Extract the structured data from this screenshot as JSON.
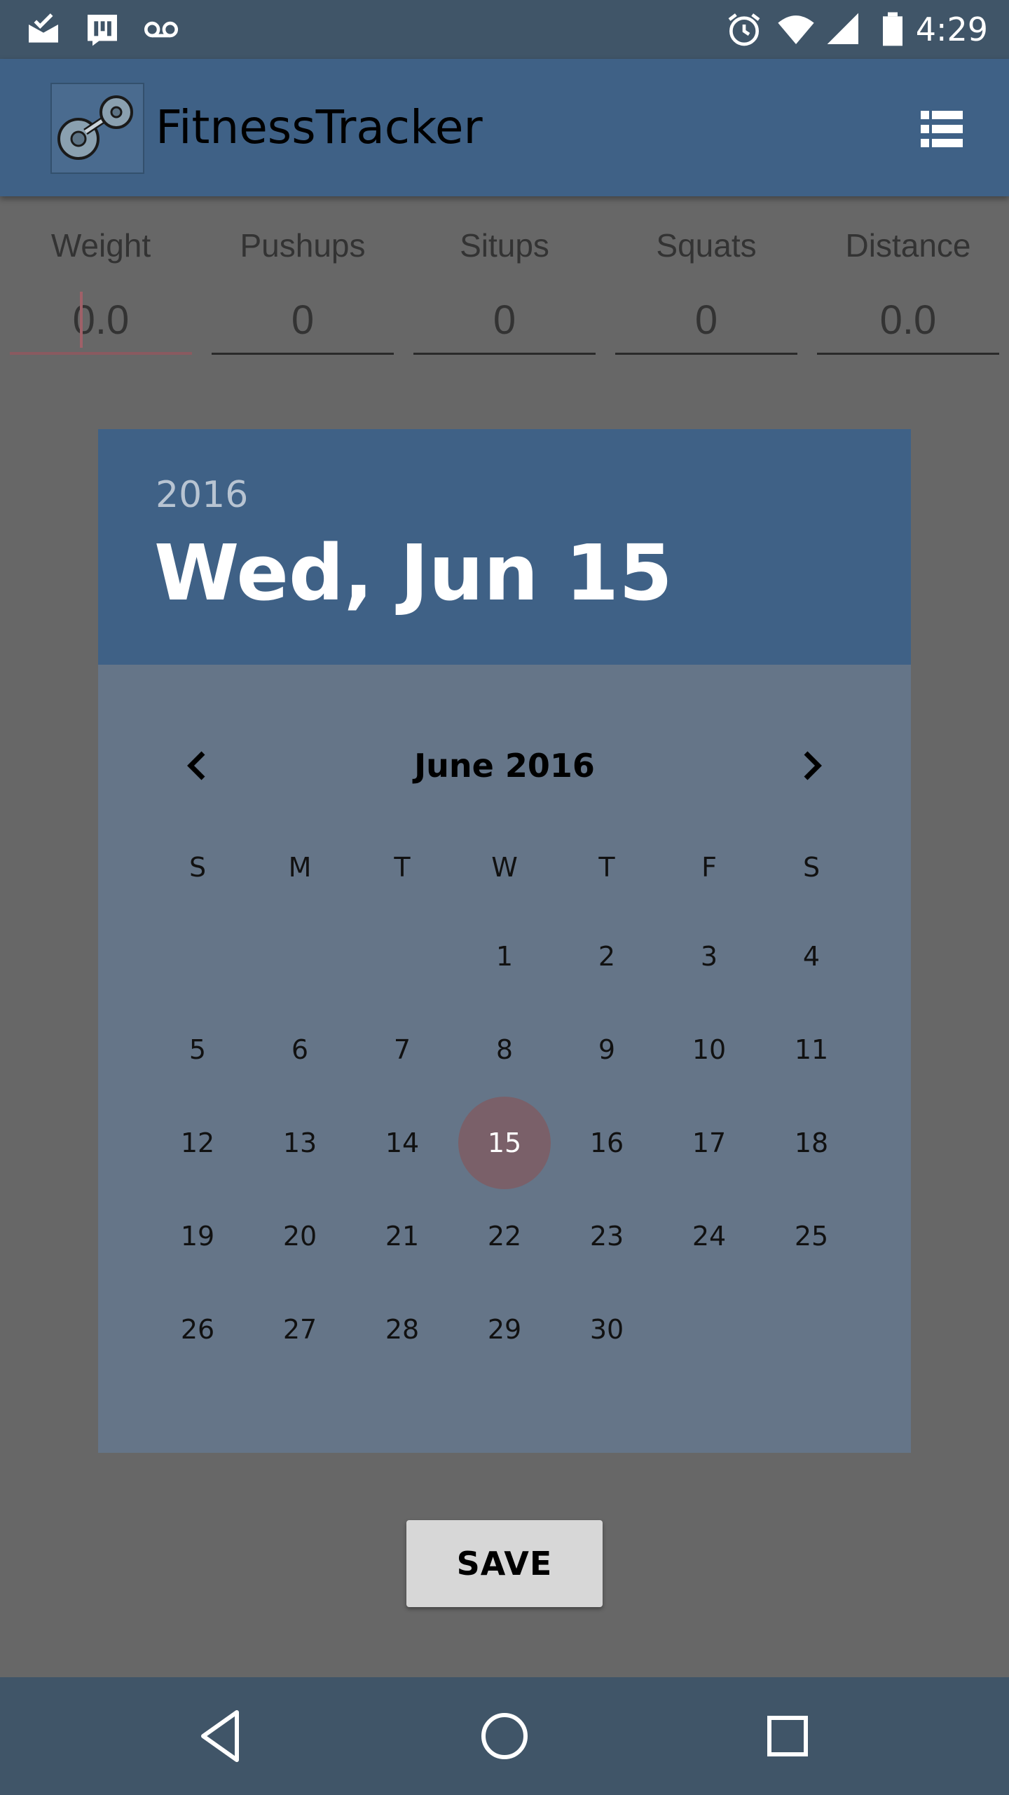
{
  "status_bar": {
    "time": "4:29",
    "icons": [
      "mail-check-icon",
      "chart-bars-icon",
      "voicemail-icon",
      "alarm-icon",
      "wifi-icon",
      "signal-icon",
      "battery-icon"
    ]
  },
  "app_bar": {
    "title": "FitnessTracker",
    "icon": "dumbbell-logo",
    "menu_icon": "list-icon",
    "color": "#3f6186"
  },
  "stats": [
    {
      "label": "Weight",
      "value": "0.0"
    },
    {
      "label": "Pushups",
      "value": "0"
    },
    {
      "label": "Situps",
      "value": "0"
    },
    {
      "label": "Squats",
      "value": "0"
    },
    {
      "label": "Distance",
      "value": "0.0"
    }
  ],
  "date_picker": {
    "year": "2016",
    "selected_date": "Wed, Jun 15",
    "month_title": "June 2016",
    "weekdays": [
      "S",
      "M",
      "T",
      "W",
      "T",
      "F",
      "S"
    ],
    "weeks": [
      [
        "",
        "",
        "",
        "1",
        "2",
        "3",
        "4"
      ],
      [
        "5",
        "6",
        "7",
        "8",
        "9",
        "10",
        "11"
      ],
      [
        "12",
        "13",
        "14",
        "15",
        "16",
        "17",
        "18"
      ],
      [
        "19",
        "20",
        "21",
        "22",
        "23",
        "24",
        "25"
      ],
      [
        "26",
        "27",
        "28",
        "29",
        "30",
        "",
        ""
      ]
    ],
    "selected_day": "15",
    "header_color": "#3f6186",
    "selection_color": "#7a6069"
  },
  "save_button": {
    "label": "SAVE"
  },
  "nav_bar": {
    "icons": [
      "back-icon",
      "home-icon",
      "recents-icon"
    ]
  }
}
